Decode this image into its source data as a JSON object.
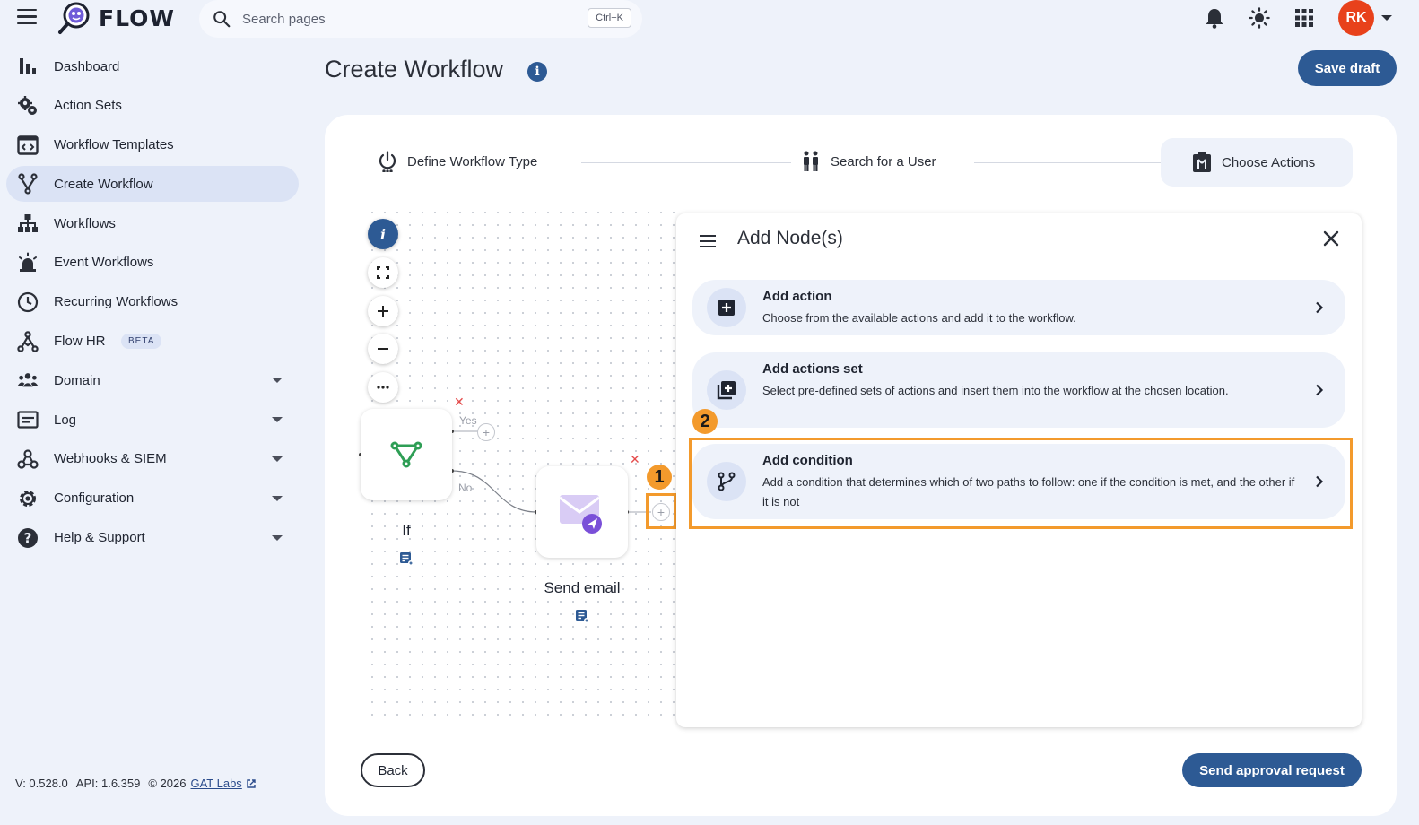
{
  "app": {
    "name": "FLOW"
  },
  "search": {
    "placeholder": "Search pages",
    "shortcut": "Ctrl+K"
  },
  "user": {
    "initials": "RK"
  },
  "sidebar": {
    "items": [
      {
        "label": "Dashboard",
        "icon": "bar-chart-icon"
      },
      {
        "label": "Action Sets",
        "icon": "gears-icon"
      },
      {
        "label": "Workflow Templates",
        "icon": "template-icon"
      },
      {
        "label": "Create Workflow",
        "icon": "fork-icon",
        "active": true
      },
      {
        "label": "Workflows",
        "icon": "sitemap-icon"
      },
      {
        "label": "Event Workflows",
        "icon": "siren-icon"
      },
      {
        "label": "Recurring Workflows",
        "icon": "clock-icon"
      },
      {
        "label": "Flow HR",
        "icon": "hr-icon",
        "badge": "BETA"
      },
      {
        "label": "Domain",
        "icon": "group-icon",
        "expandable": true
      },
      {
        "label": "Log",
        "icon": "log-icon",
        "expandable": true
      },
      {
        "label": "Webhooks & SIEM",
        "icon": "webhook-icon",
        "expandable": true
      },
      {
        "label": "Configuration",
        "icon": "gear-icon",
        "expandable": true
      },
      {
        "label": "Help & Support",
        "icon": "help-icon",
        "expandable": true
      }
    ]
  },
  "footer": {
    "version": "V: 0.528.0",
    "api": "API: 1.6.359",
    "copyright": "© 2026",
    "company": "GAT Labs"
  },
  "page": {
    "title": "Create Workflow",
    "info": "i",
    "save_draft": "Save draft"
  },
  "stepper": {
    "steps": [
      {
        "label": "Define Workflow Type"
      },
      {
        "label": "Search for a User"
      },
      {
        "label": "Choose Actions",
        "active": true
      }
    ]
  },
  "canvas": {
    "info": "i",
    "nodes": {
      "if_label": "If",
      "email_label": "Send email",
      "yes": "Yes",
      "no": "No"
    },
    "markers": {
      "one": "1",
      "two": "2"
    }
  },
  "panel": {
    "title": "Add Node(s)",
    "options": [
      {
        "title": "Add action",
        "description": "Choose from the available actions and add it to the workflow."
      },
      {
        "title": "Add actions set",
        "description": "Select pre-defined sets of actions and insert them into the workflow at the chosen location."
      },
      {
        "title": "Add condition",
        "description": "Add a condition that determines which of two paths to follow: one if the condition is met, and the other if it is not"
      }
    ]
  },
  "actions": {
    "back": "Back",
    "send": "Send approval request"
  },
  "colors": {
    "primary": "#2d5a94",
    "accent": "#f39a2c",
    "avatar": "#e8411b",
    "node_green": "#2e9e55"
  }
}
